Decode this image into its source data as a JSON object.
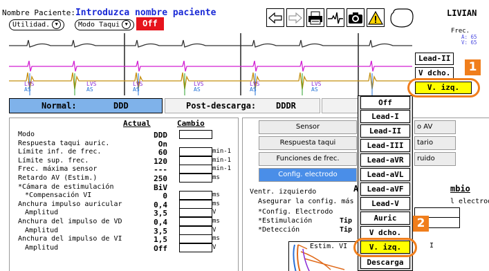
{
  "header": {
    "patient_label": "Nombre Paciente:",
    "patient_value": "Introduzca nombre paciente",
    "utilidad": "Utilidad.",
    "modo_taqui": "Modo Taqui",
    "off": "Off",
    "brand": "LIVIAN",
    "frec_label": "Frec.",
    "frec_a": "A: 65",
    "frec_v": "V: 65"
  },
  "ecg": {
    "markers": [
      {
        "top": "LVS",
        "bot": "AS"
      },
      {
        "top": "LVS",
        "bot": "AS"
      },
      {
        "top": "LVS",
        "bot": "AS"
      },
      {
        "top": "LVS",
        "bot": "AS"
      },
      {
        "top": "LVS",
        "bot": "AS"
      },
      {
        "top": "LVS",
        "bot": "AS"
      }
    ]
  },
  "right_leads": [
    "Lead-II",
    "V dcho.",
    "V. izq."
  ],
  "mode_bar": {
    "normal_label": "Normal:",
    "normal_value": "DDD",
    "post_label": "Post-descarga:",
    "post_value": "DDDR"
  },
  "table": {
    "col_actual": "Actual",
    "col_cambio": "Cambio",
    "rows": [
      {
        "label": "Modo",
        "value": "DDD",
        "unit": ""
      },
      {
        "label": "Respuesta taqui auric.",
        "value": "On",
        "unit": ""
      },
      {
        "label": "Límite inf. de frec.",
        "value": "60",
        "unit": "min-1"
      },
      {
        "label": "Límite sup. frec.",
        "value": "120",
        "unit": "min-1"
      },
      {
        "label": "Frec. máxima sensor",
        "value": "---",
        "unit": "min-1"
      },
      {
        "label": "Retardo AV (Estim.)",
        "value": "250",
        "unit": "ms"
      },
      {
        "label": "*Cámara de estimulación",
        "value": "BiV",
        "unit": ""
      },
      {
        "label": "*Compensación VI",
        "value": "0",
        "unit": "ms"
      },
      {
        "label": "Anchura impulso auricular",
        "value": "0,4",
        "unit": "ms"
      },
      {
        "label": "Amplitud",
        "value": "3,5",
        "unit": "V"
      },
      {
        "label": "Anchura del impulso de VD",
        "value": "0,4",
        "unit": "ms"
      },
      {
        "label": "Amplitud",
        "value": "3,5",
        "unit": "V"
      },
      {
        "label": "Anchura del impulso de VI",
        "value": "1,5",
        "unit": "ms"
      },
      {
        "label": "Amplitud",
        "value": "Off",
        "unit": "V"
      }
    ]
  },
  "right_panel": {
    "sensor": "Sensor",
    "respuesta": "Respuesta taqui",
    "funciones": "Funciones de frec.",
    "config": "Config. electrodo",
    "retardo_av": "o AV",
    "tario": "tario",
    "ruido": "ruido",
    "ventr": "Ventr. izquierdo",
    "asegurar": "Asegurar la config. más",
    "config_electrodo": "*Config. Electrodo",
    "estimulacion": "*Estimulación",
    "deteccion": "*Detección",
    "tip1": "Tip",
    "tip2": "Tip",
    "a_lbl": "A",
    "mbio": "mbio",
    "electrodo": "l electrodo",
    "estim_vi": "Estim. VI",
    "i_lbl": "I"
  },
  "dropdown": {
    "items": [
      "Off",
      "Lead-I",
      "Lead-II",
      "Lead-III",
      "Lead-aVR",
      "Lead-aVL",
      "Lead-aVF",
      "Lead-V",
      "Auric",
      "V dcho.",
      "V. izq.",
      "Descarga"
    ],
    "selected": "V. izq."
  },
  "callouts": [
    "1",
    "2"
  ],
  "colors": {
    "accent_blue": "#1a2ad6",
    "off_red": "#e6131c",
    "callout_orange": "#f07e1c",
    "selected_yellow": "#ffff00",
    "mode_blue": "#7fb2ea"
  }
}
